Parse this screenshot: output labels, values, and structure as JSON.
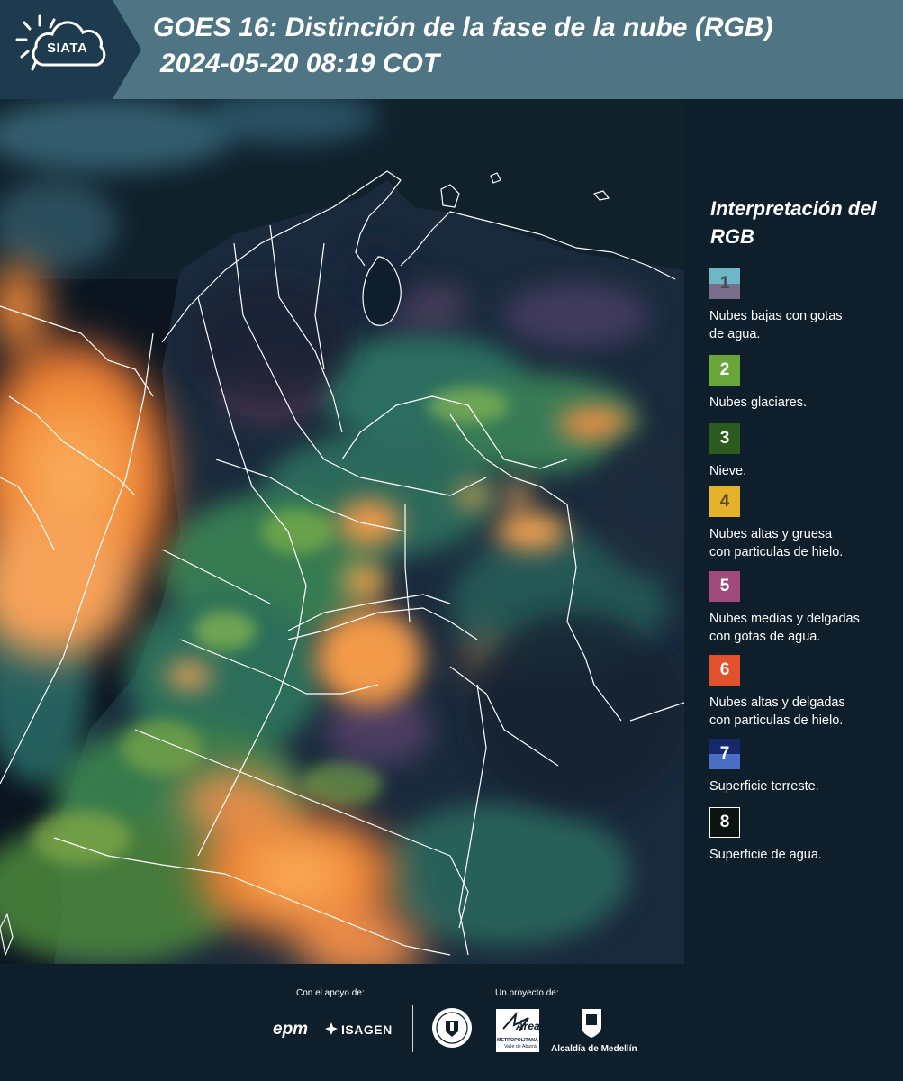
{
  "header": {
    "logo_text": "SIATA",
    "title_line1": "GOES 16: Distinción de la fase de la nube (RGB)",
    "title_line2": "2024-05-20 08:19 COT"
  },
  "map": {
    "name": "goes16-rgb-satellite-image",
    "colors": {
      "ocean": "#0b1420",
      "land": "#1f2f3a",
      "border": "#ffffff",
      "high_ice_cloud": "#f4943f"
    }
  },
  "legend": {
    "title": "Interpretación del RGB",
    "items": [
      {
        "number": "1",
        "label": "Nubes bajas con gotas\nde agua.",
        "color_top": "#6eb7c6",
        "color_bottom": "#7a6f8b",
        "text_color": "#4a4a5a"
      },
      {
        "number": "2",
        "label": "Nubes glaciares.",
        "color": "#6aa53a",
        "text_color": "#ffffff"
      },
      {
        "number": "3",
        "label": "Nieve.",
        "color": "#2d5a1f",
        "text_color": "#ffffff"
      },
      {
        "number": "4",
        "label": "Nubes altas y gruesa\ncon particulas de hielo.",
        "color": "#e6b12a",
        "text_color": "#5a4a2a"
      },
      {
        "number": "5",
        "label": "Nubes medias y delgadas\ncon gotas de agua.",
        "color": "#a14a7e",
        "text_color": "#ffffff"
      },
      {
        "number": "6",
        "label": "Nubes altas y delgadas\ncon particulas de hielo.",
        "color": "#e1512c",
        "text_color": "#ffffff"
      },
      {
        "number": "7",
        "label": "Superficie terreste.",
        "color_top": "#15296b",
        "color_bottom": "#4a6fc5",
        "text_color": "#ffffff"
      },
      {
        "number": "8",
        "label": "Superficie de agua.",
        "color": "#0b1410",
        "text_color": "#ffffff",
        "border": "#ffffff"
      }
    ]
  },
  "footer": {
    "support_caption": "Con el apoyo de:",
    "project_caption": "Un proyecto de:",
    "sponsors": [
      "epm",
      "ISAGEN"
    ],
    "partners": [
      "Universidad Nacional de Colombia",
      "Área Metropolitana Valle de Aburrá",
      "Alcaldía de Medellín"
    ],
    "area_text": "Área",
    "area_sub1": "METROPOLITANA",
    "area_sub2": "Valle de Aburrá",
    "alcaldia_text": "Alcaldía de Medellín"
  }
}
